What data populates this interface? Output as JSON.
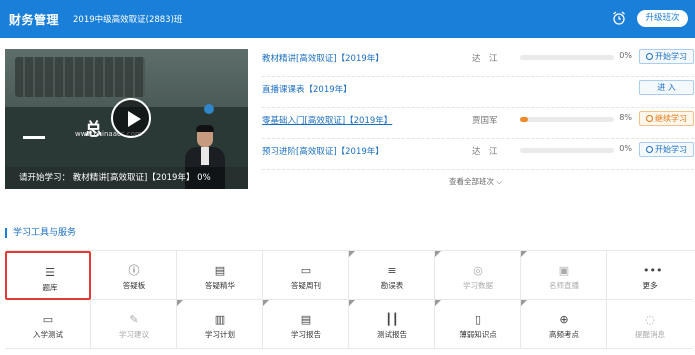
{
  "header": {
    "brand": "财务管理",
    "class_name": "2019中级高效取证(2883)班",
    "upgrade_label": "升级班次"
  },
  "video": {
    "board_char": "总",
    "site_text": "www.chinaacc.com",
    "caption": "请开始学习： 教材精讲[高效取证]【2019年】 0%"
  },
  "courses": [
    {
      "title": "教材精讲[高效取证]【2019年】",
      "teacher": "达　江",
      "progress": 0,
      "percent": "0%",
      "action": "开始学习"
    },
    {
      "title": "直播课课表【2019年】",
      "teacher": "",
      "progress": null,
      "percent": "",
      "action": "进 入"
    },
    {
      "title": "零基础入门[高效取证]【2019年】",
      "teacher": "贾国军",
      "progress": 8,
      "percent": "8%",
      "action": "继续学习"
    },
    {
      "title": "预习进阶[高效取证]【2019年】",
      "teacher": "达　江",
      "progress": 0,
      "percent": "0%",
      "action": "开始学习"
    }
  ],
  "all_classes_label": "查看全部班次 ⌵",
  "tools": {
    "title": "学习工具与服务",
    "row1": [
      {
        "label": "题库",
        "icon": "list-icon"
      },
      {
        "label": "答疑板",
        "icon": "question-icon"
      },
      {
        "label": "答疑精华",
        "icon": "book-icon"
      },
      {
        "label": "答疑周刊",
        "icon": "document-icon"
      },
      {
        "label": "勘误表",
        "icon": "list-icon"
      },
      {
        "label": "学习数据",
        "icon": "target-icon"
      },
      {
        "label": "名师直播",
        "icon": "camera-icon"
      },
      {
        "label": "更多",
        "icon": "more-icon"
      }
    ],
    "row2": [
      {
        "label": "入学测试",
        "icon": "monitor-icon"
      },
      {
        "label": "学习建议",
        "icon": "edit-icon"
      },
      {
        "label": "学习计划",
        "icon": "calendar-icon"
      },
      {
        "label": "学习报告",
        "icon": "report-icon"
      },
      {
        "label": "测试报告",
        "icon": "bar-chart-icon"
      },
      {
        "label": "薄弱知识点",
        "icon": "book-icon"
      },
      {
        "label": "高频考点",
        "icon": "crosshair-icon"
      },
      {
        "label": "提醒消息",
        "icon": "message-icon"
      }
    ]
  },
  "colors": {
    "header_blue": "#1a7fd8",
    "link_blue": "#1a6fc4",
    "orange": "#f08a2c",
    "highlight_red": "#e53935"
  }
}
